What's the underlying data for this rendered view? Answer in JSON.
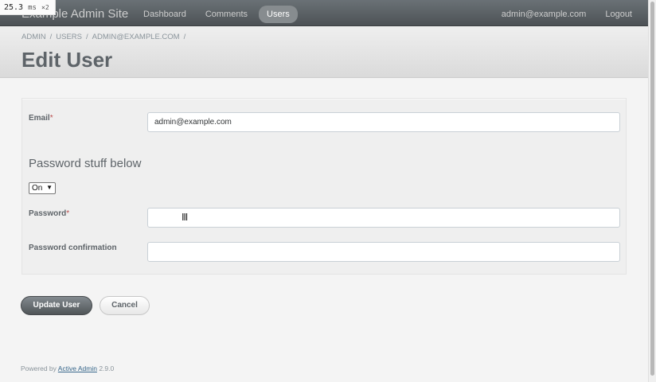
{
  "header": {
    "site_title": "Example Admin Site",
    "nav": [
      {
        "label": "Dashboard"
      },
      {
        "label": "Comments"
      },
      {
        "label": "Users",
        "active": true
      }
    ],
    "current_user": "admin@example.com",
    "logout_label": "Logout"
  },
  "perf_badge": {
    "value": "25.3",
    "unit": "ms",
    "multiplier": "×2"
  },
  "breadcrumb": [
    "ADMIN",
    "USERS",
    "ADMIN@EXAMPLE.COM"
  ],
  "breadcrumb_sep": "/",
  "page_title": "Edit User",
  "form": {
    "email_label": "Email",
    "required_marker": "*",
    "email_value": "admin@example.com",
    "section_heading": "Password stuff below",
    "toggle_value": "On",
    "password_label": "Password",
    "password_value": "",
    "password_confirmation_label": "Password confirmation",
    "password_confirmation_value": ""
  },
  "actions": {
    "submit": "Update User",
    "cancel": "Cancel"
  },
  "footer": {
    "prefix": "Powered by",
    "link": "Active Admin",
    "version": "2.9.0"
  },
  "colors": {
    "header": "#5c6267",
    "accent_link": "#38678b",
    "required": "#ba4d4d"
  }
}
